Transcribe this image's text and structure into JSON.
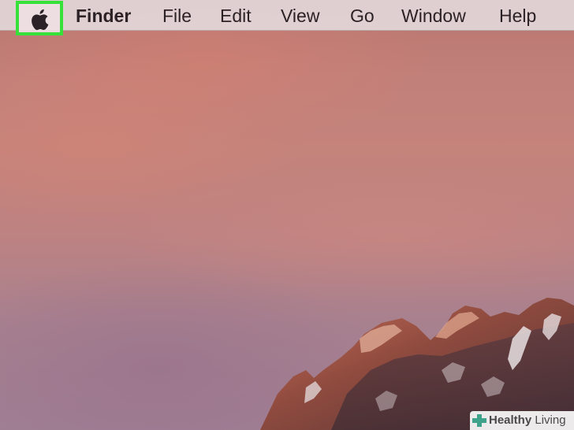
{
  "menubar": {
    "apple_menu": {
      "icon": "apple-logo-icon",
      "highlight_color": "#36e23a"
    },
    "items": [
      {
        "label": "Finder",
        "bold": true
      },
      {
        "label": "File"
      },
      {
        "label": "Edit"
      },
      {
        "label": "View"
      },
      {
        "label": "Go"
      },
      {
        "label": "Window"
      },
      {
        "label": "Help"
      }
    ]
  },
  "desktop": {
    "wallpaper": "sierra-mountain-sunset"
  },
  "watermark": {
    "brand": "Healthy",
    "suffix": " Living",
    "accent_color": "#3fa38c"
  }
}
